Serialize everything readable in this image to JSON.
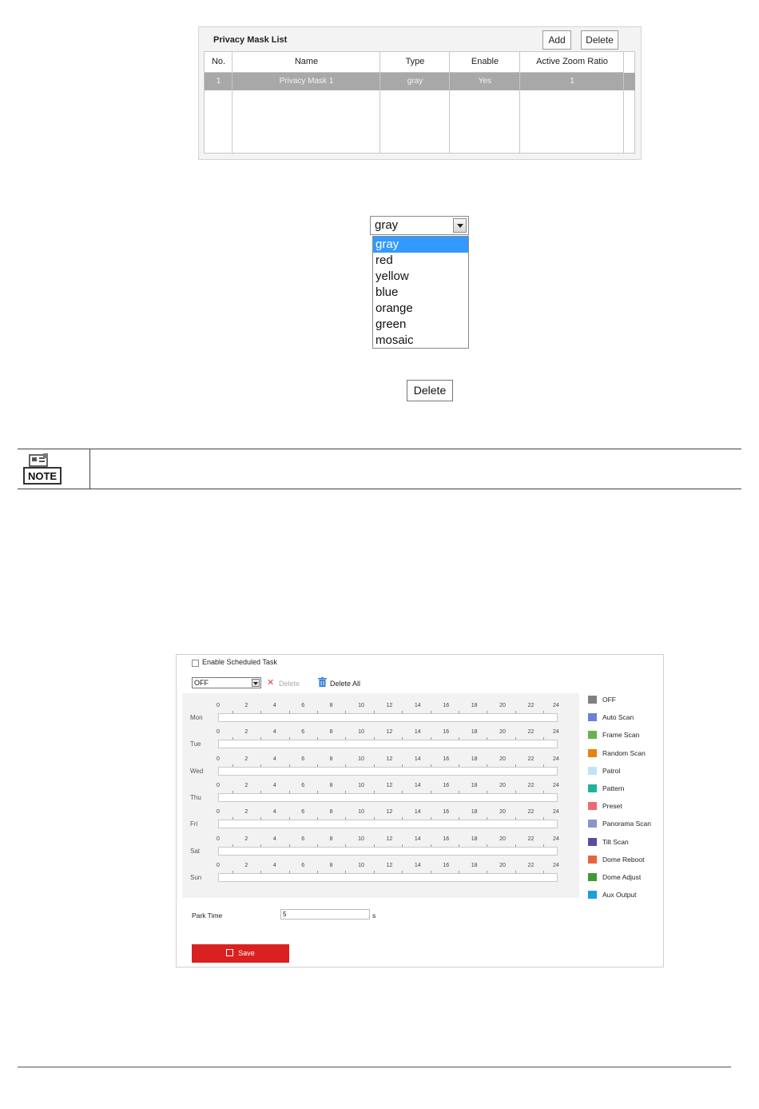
{
  "privacy_mask": {
    "title": "Privacy Mask List",
    "add_label": "Add",
    "delete_label": "Delete",
    "columns": [
      "No.",
      "Name",
      "Type",
      "Enable",
      "Active Zoom Ratio"
    ],
    "rows": [
      {
        "no": "1",
        "name": "Privacy Mask 1",
        "type": "gray",
        "enable": "Yes",
        "zoom": "1"
      }
    ]
  },
  "type_dropdown": {
    "value": "gray",
    "options": [
      "gray",
      "red",
      "yellow",
      "blue",
      "orange",
      "green",
      "mosaic"
    ],
    "selected_index": 0
  },
  "delete_button": {
    "label": "Delete"
  },
  "note": {
    "icon": "note-icon",
    "label": "NOTE"
  },
  "scheduled_task": {
    "enable_label": "Enable Scheduled Task",
    "enabled": false,
    "task_select_value": "OFF",
    "delete_label": "Delete",
    "delete_all_label": "Delete All",
    "days": [
      "Mon",
      "Tue",
      "Wed",
      "Thu",
      "Fri",
      "Sat",
      "Sun"
    ],
    "hour_ticks": [
      "0",
      "2",
      "4",
      "6",
      "8",
      "10",
      "12",
      "14",
      "16",
      "18",
      "20",
      "22",
      "24"
    ],
    "legend": [
      {
        "label": "OFF",
        "color": "#808080"
      },
      {
        "label": "Auto Scan",
        "color": "#6b7fe0"
      },
      {
        "label": "Frame Scan",
        "color": "#66b34f"
      },
      {
        "label": "Random Scan",
        "color": "#e8830c"
      },
      {
        "label": "Patrol",
        "color": "#bfe3f7"
      },
      {
        "label": "Pattern",
        "color": "#1fb39a"
      },
      {
        "label": "Preset",
        "color": "#ee6a6f"
      },
      {
        "label": "Panorama Scan",
        "color": "#8a95c8"
      },
      {
        "label": "Tilt Scan",
        "color": "#5a4d9c"
      },
      {
        "label": "Dome Reboot",
        "color": "#e8643c"
      },
      {
        "label": "Dome Adjust",
        "color": "#3f9a35"
      },
      {
        "label": "Aux Output",
        "color": "#1e9fd8"
      }
    ],
    "park_time_label": "Park Time",
    "park_time_value": "5",
    "park_time_unit": "s",
    "save_label": "Save"
  }
}
